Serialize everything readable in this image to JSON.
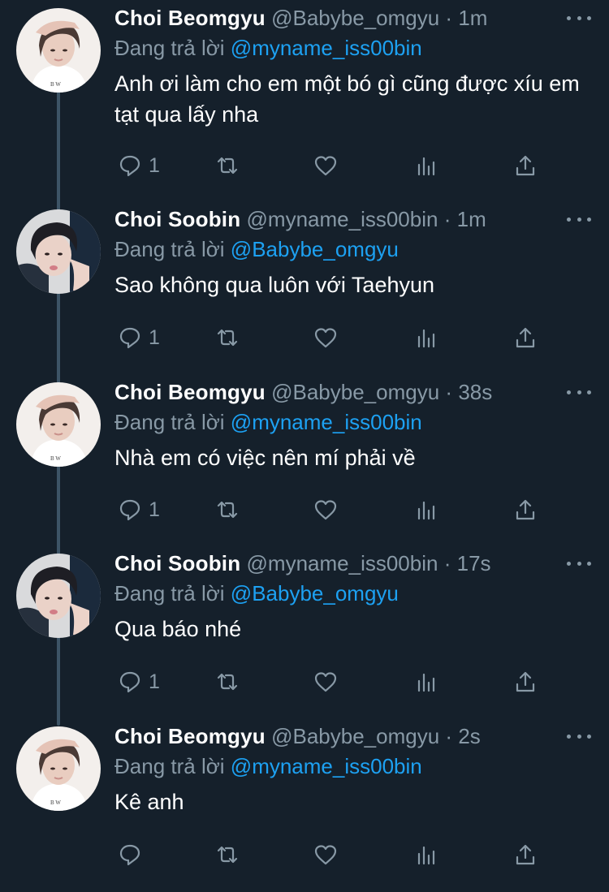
{
  "replying_prefix": "Đang trả lời",
  "tweets": [
    {
      "name": "Choi Beomgyu",
      "handle": "@Babybe_omgyu",
      "time": "1m",
      "reply_to": "@myname_iss00bin",
      "text": "Anh ơi làm cho em một bó gì cũng được xíu em tạt qua lấy nha",
      "reply_count": "1",
      "avatar": "beomgyu-avatar"
    },
    {
      "name": "Choi Soobin",
      "handle": "@myname_iss00bin",
      "time": "1m",
      "reply_to": "@Babybe_omgyu",
      "text": "Sao không qua luôn với Taehyun",
      "reply_count": "1",
      "avatar": "soobin-avatar"
    },
    {
      "name": "Choi Beomgyu",
      "handle": "@Babybe_omgyu",
      "time": "38s",
      "reply_to": "@myname_iss00bin",
      "text": "Nhà em có việc nên mí phải về",
      "reply_count": "1",
      "avatar": "beomgyu-avatar"
    },
    {
      "name": "Choi Soobin",
      "handle": "@myname_iss00bin",
      "time": "17s",
      "reply_to": "@Babybe_omgyu",
      "text": "Qua báo nhé",
      "reply_count": "1",
      "avatar": "soobin-avatar"
    },
    {
      "name": "Choi Beomgyu",
      "handle": "@Babybe_omgyu",
      "time": "2s",
      "reply_to": "@myname_iss00bin",
      "text": "Kê anh",
      "reply_count": "",
      "avatar": "beomgyu-avatar"
    }
  ],
  "colors": {
    "background": "#15202b",
    "text": "#ffffff",
    "secondary": "#8899a6",
    "link": "#1da1f2",
    "thread_line": "#3d5466"
  }
}
